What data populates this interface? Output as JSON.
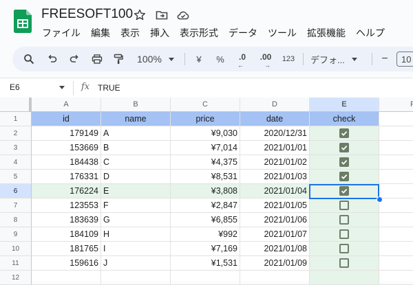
{
  "document": {
    "title": "FREESOFT100"
  },
  "menu": [
    "ファイル",
    "編集",
    "表示",
    "挿入",
    "表示形式",
    "データ",
    "ツール",
    "拡張機能",
    "ヘルプ"
  ],
  "toolbar": {
    "zoom": "100%",
    "currency": "¥",
    "percent": "%",
    "decrease_decimal": ".0",
    "increase_decimal": ".00",
    "format_number": "123",
    "font": "デフォ...",
    "minus": "−",
    "font_size": "10"
  },
  "formula_bar": {
    "cell_ref": "E6",
    "fx": "fx",
    "value": "TRUE"
  },
  "columns": [
    "A",
    "B",
    "C",
    "D",
    "E",
    "F"
  ],
  "row_numbers": [
    "1",
    "2",
    "3",
    "4",
    "5",
    "6",
    "7",
    "8",
    "9",
    "10",
    "11",
    "12"
  ],
  "headers": {
    "id": "id",
    "name": "name",
    "price": "price",
    "date": "date",
    "check": "check"
  },
  "rows": [
    {
      "id": "179149",
      "name": "A",
      "price": "¥9,030",
      "date": "2020/12/31",
      "check": true
    },
    {
      "id": "153669",
      "name": "B",
      "price": "¥7,014",
      "date": "2021/01/01",
      "check": true
    },
    {
      "id": "184438",
      "name": "C",
      "price": "¥4,375",
      "date": "2021/01/02",
      "check": true
    },
    {
      "id": "176331",
      "name": "D",
      "price": "¥8,531",
      "date": "2021/01/03",
      "check": true
    },
    {
      "id": "176224",
      "name": "E",
      "price": "¥3,808",
      "date": "2021/01/04",
      "check": true
    },
    {
      "id": "123553",
      "name": "F",
      "price": "¥2,847",
      "date": "2021/01/05",
      "check": false
    },
    {
      "id": "183639",
      "name": "G",
      "price": "¥6,855",
      "date": "2021/01/06",
      "check": false
    },
    {
      "id": "184109",
      "name": "H",
      "price": "¥992",
      "date": "2021/01/07",
      "check": false
    },
    {
      "id": "181765",
      "name": "I",
      "price": "¥7,169",
      "date": "2021/01/08",
      "check": false
    },
    {
      "id": "159616",
      "name": "J",
      "price": "¥1,531",
      "date": "2021/01/09",
      "check": false
    }
  ],
  "selection": {
    "cell": "E6"
  },
  "colors": {
    "header_fill": "#a4c2f4",
    "check_column_fill": "#e6f4ea",
    "checkbox": "#6b7d66",
    "selection": "#1a73e8"
  }
}
